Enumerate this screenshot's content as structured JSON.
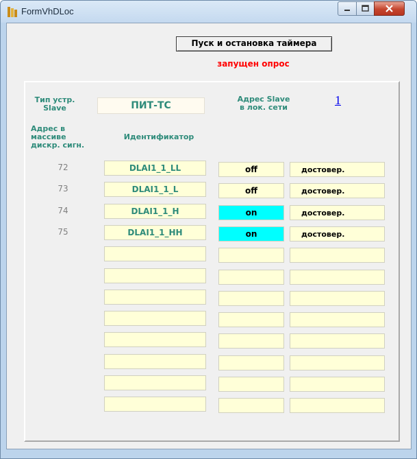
{
  "window": {
    "title": "FormVhDLoc"
  },
  "toolbar": {
    "timer_button": "Пуск и остановка таймера",
    "status": "запущен опрос"
  },
  "header": {
    "device_type_label": "Тип устр.\nSlave",
    "device_type_value": "ПИТ-ТС",
    "slave_address_label": "Адрес Slave\nв лок.  сети",
    "slave_address_value": "1",
    "array_address_label": "Адрес в\nмассиве\nдискр. сигн.",
    "identifier_label": "Идентификатор"
  },
  "rows": [
    {
      "num": "72",
      "id": "DLAI1_1_LL",
      "state": "off",
      "quality": "достовер."
    },
    {
      "num": "73",
      "id": "DLAI1_1_L",
      "state": "off",
      "quality": "достовер."
    },
    {
      "num": "74",
      "id": "DLAI1_1_H",
      "state": "on",
      "quality": "достовер."
    },
    {
      "num": "75",
      "id": "DLAI1_1_HH",
      "state": "on",
      "quality": "достовер."
    },
    {
      "num": "",
      "id": "",
      "state": "",
      "quality": ""
    },
    {
      "num": "",
      "id": "",
      "state": "",
      "quality": ""
    },
    {
      "num": "",
      "id": "",
      "state": "",
      "quality": ""
    },
    {
      "num": "",
      "id": "",
      "state": "",
      "quality": ""
    },
    {
      "num": "",
      "id": "",
      "state": "",
      "quality": ""
    },
    {
      "num": "",
      "id": "",
      "state": "",
      "quality": ""
    },
    {
      "num": "",
      "id": "",
      "state": "",
      "quality": ""
    },
    {
      "num": "",
      "id": "",
      "state": "",
      "quality": ""
    }
  ],
  "colors": {
    "on_state": "#00ffff",
    "label_teal": "#2e8b7a",
    "cell_bg": "#ffffd8",
    "status_red": "#ff0000"
  }
}
